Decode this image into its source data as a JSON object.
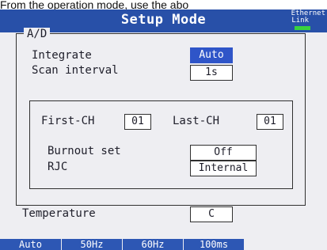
{
  "caption": "From the operation mode, use the abo",
  "header": {
    "title": "Setup Mode",
    "ethernet_label": "Ethernet",
    "link_label": "Link"
  },
  "ad_group": {
    "label": "A/D",
    "integrate": {
      "label": "Integrate",
      "value": "Auto"
    },
    "scan_interval": {
      "label": "Scan interval",
      "value": "1s"
    },
    "channel_group": {
      "first_ch": {
        "label": "First-CH",
        "value": "01"
      },
      "last_ch": {
        "label": "Last-CH",
        "value": "01"
      },
      "burnout_set": {
        "label": "Burnout set",
        "value": "Off"
      },
      "rjc": {
        "label": "RJC",
        "value": "Internal"
      }
    }
  },
  "temperature": {
    "label": "Temperature",
    "value": "C"
  },
  "softkeys": [
    "Auto",
    "50Hz",
    "60Hz",
    "100ms"
  ],
  "colors": {
    "title_bar": "#2850a8",
    "selected_field": "#2f55c8",
    "link_led": "#39d23f",
    "screen_bg": "#eeeef2"
  }
}
